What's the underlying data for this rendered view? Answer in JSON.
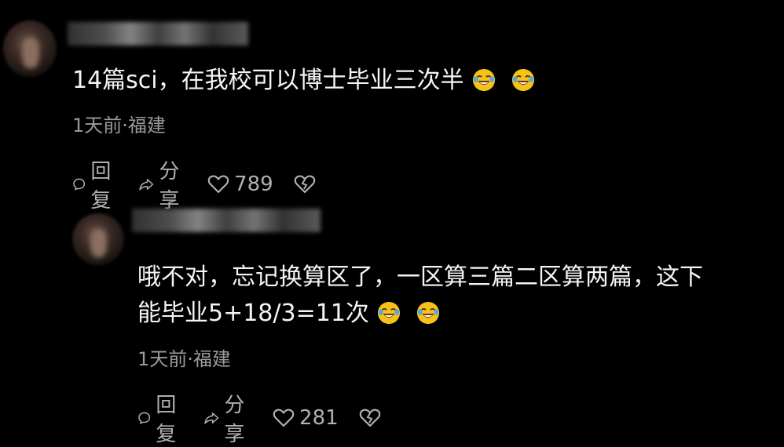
{
  "comments": [
    {
      "text_line1": "14篇sci，在我校可以博士毕业三次半",
      "meta": "1天前·福建",
      "reply_label": "回复",
      "share_label": "分享",
      "like_count": "789",
      "emojis": [
        "laugh-cry-emoji",
        "laugh-cry-emoji"
      ]
    },
    {
      "text_line1": "哦不对，忘记换算区了，一区算三篇二区算两篇，这下",
      "text_line2": "能毕业5+18/3=11次",
      "meta": "1天前·福建",
      "reply_label": "回复",
      "share_label": "分享",
      "like_count": "281",
      "emojis": [
        "laugh-cry-emoji",
        "laugh-cry-emoji"
      ]
    }
  ],
  "colors": {
    "background": "#000000",
    "text": "#f5f5f5",
    "meta": "#9a9a9a",
    "emoji_face": "#f6c21a"
  }
}
